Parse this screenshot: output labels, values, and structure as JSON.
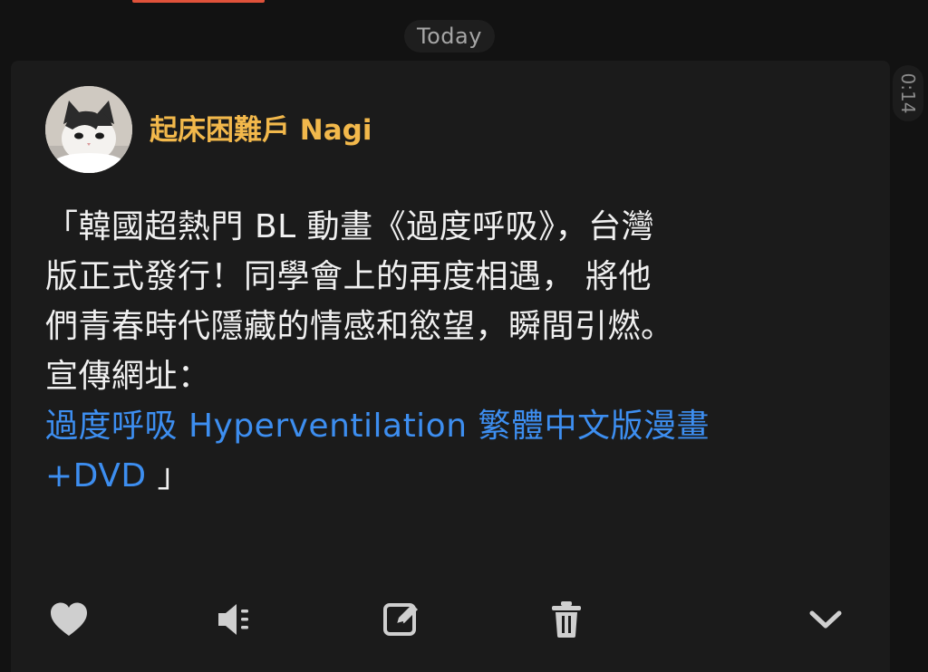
{
  "date_separator": "Today",
  "message_time": "0:14",
  "post": {
    "author": "起床困難戶 Nagi",
    "lines": [
      "「韓國超熱門 BL 動畫《過度呼吸》，台灣",
      "版正式發行！同學會上的再度相遇， 將他",
      "們青春時代隱藏的情感和慾望，瞬間引燃。",
      "宣傳網址："
    ],
    "link_lines": [
      "過度呼吸 Hyperventilation 繁體中文版漫畫",
      "+DVD"
    ],
    "closing_quote": " 」"
  },
  "actions": [
    {
      "name": "heart-icon"
    },
    {
      "name": "speaker-icon"
    },
    {
      "name": "edit-icon"
    },
    {
      "name": "trash-icon"
    },
    {
      "name": "chevron-down-icon"
    }
  ],
  "colors": {
    "background": "#121212",
    "card": "#1b1b1b",
    "author": "#f2b84b",
    "link": "#3d8ef0",
    "text": "#f0f0f0",
    "icon": "#cfcfcf"
  }
}
